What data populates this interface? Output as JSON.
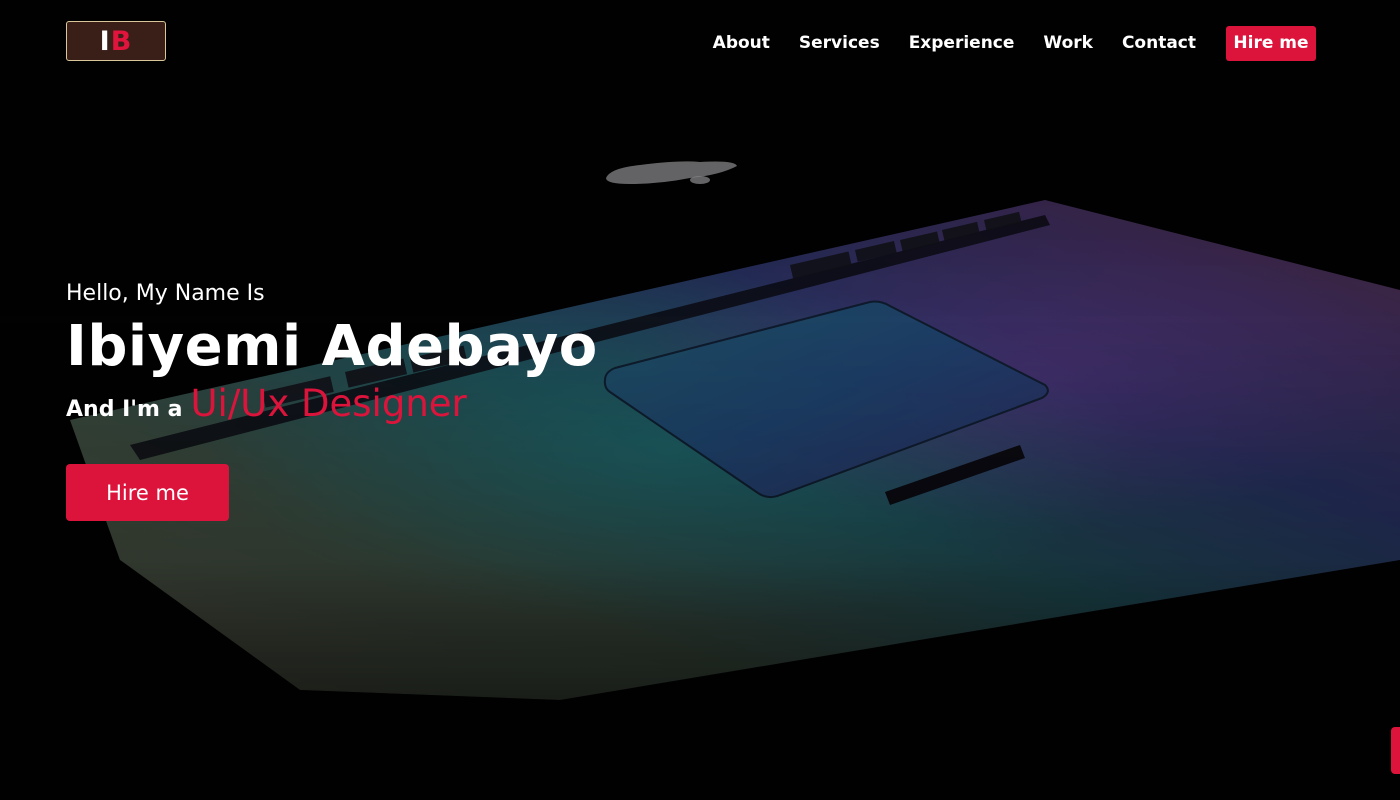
{
  "brand": {
    "logo_letter_1": "I",
    "logo_letter_2": "B"
  },
  "nav": {
    "links": [
      {
        "label": "About"
      },
      {
        "label": "Services"
      },
      {
        "label": "Experience"
      },
      {
        "label": "Work"
      },
      {
        "label": "Contact"
      }
    ],
    "hire_label": "Hire me"
  },
  "hero": {
    "greeting": "Hello, My Name Is",
    "name": "Ibiyemi Adebayo",
    "role_prefix": "And I'm a",
    "role": "Ui/Ux Designer",
    "cta_label": "Hire me",
    "background_image": "dark laptop keyboard and trackpad"
  },
  "colors": {
    "accent": "#dc143c",
    "background": "#030305",
    "text": "#ffffff",
    "logo_border": "#d9c79a",
    "logo_bg": "#3a1f18"
  },
  "icons": {
    "scroll_tab": "scroll-to-top-tab"
  }
}
